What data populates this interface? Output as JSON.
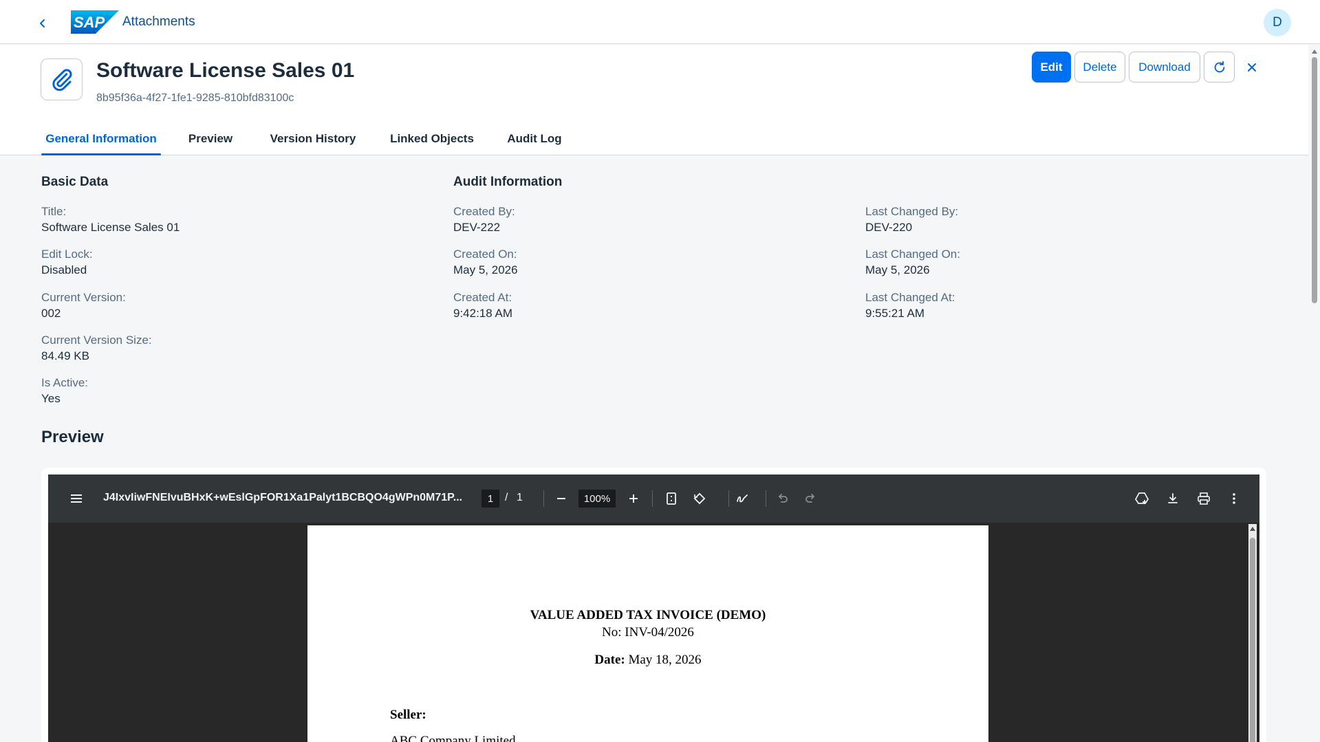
{
  "shell": {
    "app_title": "Attachments",
    "logo_text": "SAP",
    "avatar_initial": "D"
  },
  "header": {
    "title": "Software License Sales 01",
    "subtitle": "8b95f36a-4f27-1fe1-9285-810bfd83100c",
    "actions": {
      "edit": "Edit",
      "delete": "Delete",
      "download": "Download"
    },
    "tabs": [
      {
        "label": "General Information",
        "active": true
      },
      {
        "label": "Preview",
        "active": false
      },
      {
        "label": "Version History",
        "active": false
      },
      {
        "label": "Linked Objects",
        "active": false
      },
      {
        "label": "Audit Log",
        "active": false
      }
    ]
  },
  "basic_data": {
    "title": "Basic Data",
    "fields": [
      {
        "label": "Title:",
        "value": "Software License Sales 01"
      },
      {
        "label": "Edit Lock:",
        "value": "Disabled"
      },
      {
        "label": "Current Version:",
        "value": "002"
      },
      {
        "label": "Current Version Size:",
        "value": "84.49 KB"
      },
      {
        "label": "Is Active:",
        "value": "Yes"
      }
    ]
  },
  "audit_info": {
    "title": "Audit Information",
    "created": [
      {
        "label": "Created By:",
        "value": "DEV-222"
      },
      {
        "label": "Created On:",
        "value": "May 5, 2026"
      },
      {
        "label": "Created At:",
        "value": "9:42:18 AM"
      }
    ],
    "changed": [
      {
        "label": "Last Changed By:",
        "value": "DEV-220"
      },
      {
        "label": "Last Changed On:",
        "value": "May 5, 2026"
      },
      {
        "label": "Last Changed At:",
        "value": "9:55:21 AM"
      }
    ]
  },
  "preview": {
    "heading": "Preview",
    "viewer": {
      "filename": "J4IxvIiwFNEIvuBHxK+wEslGpFOR1Xa1Palyt1BCBQO4gWPn0M71P...",
      "page_current": "1",
      "page_separator": "/",
      "page_total": "1",
      "zoom": "100%"
    },
    "document": {
      "title": "VALUE ADDED TAX INVOICE (DEMO)",
      "number": "No: INV-04/2026",
      "date_label": "Date:",
      "date_value": "May 18, 2026",
      "seller_label": "Seller:",
      "seller_name": "ABC Company Limited"
    }
  },
  "colors": {
    "brand": "#0070f2",
    "link": "#0064d9",
    "text": "#1d2d3e",
    "muted": "#556b82",
    "background": "#f5f6f7"
  }
}
